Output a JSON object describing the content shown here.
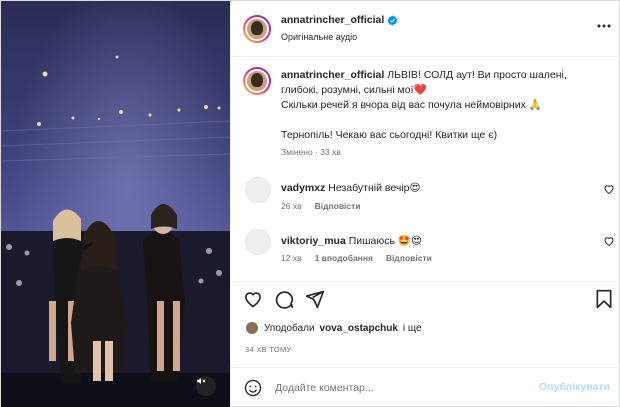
{
  "post": {
    "username": "annatrincher_official",
    "audio": "Оригінальне аудіо",
    "caption_lines": [
      "ЛЬВІВ! СОЛД аут! Ви просто шалені,",
      "глибокі, розумні, сильні мої❤️",
      "Скільки речей я вчора від вас почула неймовірних 🙏",
      "",
      "Тернопіль! Чекаю вас сьогодні! Квитки ще є)"
    ],
    "caption_meta": "Змінено · 33 хв"
  },
  "comments": [
    {
      "username": "vadymxz",
      "text": "Незабутній вечір😍",
      "time": "26 хв",
      "likes": "",
      "reply": "Відповісти"
    },
    {
      "username": "viktoriy_mua",
      "text": "Пишаюсь 🤩😍",
      "time": "12 хв",
      "likes": "1 вподобання",
      "reply": "Відповісти"
    }
  ],
  "likes": {
    "prefix": "Уподобали",
    "user": "vova_ostapchuk",
    "suffix": "і ще"
  },
  "timeago": "34 ХВ ТОМУ",
  "add_comment": {
    "placeholder": "Додайте коментар...",
    "post_label": "Опублікувати"
  },
  "icons": {
    "verified": "verified-badge-icon",
    "more": "more-options-icon",
    "like": "heart-icon",
    "comment": "comment-icon",
    "share": "share-icon",
    "save": "bookmark-icon",
    "emoji": "emoji-icon",
    "mute": "speaker-muted-icon"
  },
  "colors": {
    "verified_blue": "#0095f6",
    "post_button_disabled": "#b3dbff",
    "muted_text": "#737373"
  }
}
